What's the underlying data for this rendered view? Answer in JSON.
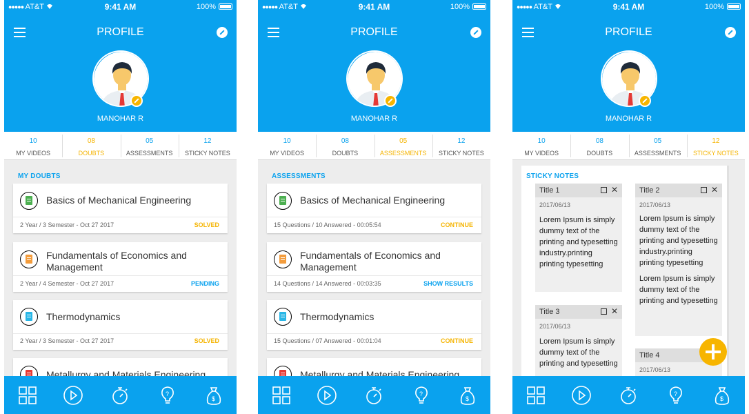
{
  "status_bar": {
    "carrier": "AT&T",
    "time": "9:41 AM",
    "battery": "100%"
  },
  "header": {
    "title": "PROFILE",
    "username": "MANOHAR R"
  },
  "stats": [
    {
      "count": "10",
      "label": "MY VIDEOS"
    },
    {
      "count": "08",
      "label": "DOUBTS"
    },
    {
      "count": "05",
      "label": "ASSESSMENTS"
    },
    {
      "count": "12",
      "label": "STICKY NOTES"
    }
  ],
  "screens": {
    "doubts": {
      "active_tab": 1,
      "section_title": "MY DOUBTS",
      "items": [
        {
          "title": "Basics of Mechanical Engineering",
          "meta": "2 Year / 3 Semester - Oct 27 2017",
          "status": "SOLVED",
          "icon": "document-icon",
          "color": "#4caf50"
        },
        {
          "title": "Fundamentals of Economics and Management",
          "meta": "2 Year / 4 Semester - Oct 27 2017",
          "status": "PENDING",
          "icon": "document-icon",
          "color": "#f39c3c"
        },
        {
          "title": "Thermodynamics",
          "meta": "2 Year / 3 Semester - Oct 27 2017",
          "status": "SOLVED",
          "icon": "document-icon",
          "color": "#29b6e6"
        },
        {
          "title": "Metallurgy and Materials Engineering",
          "icon": "document-icon",
          "color": "#e53935"
        }
      ]
    },
    "assessments": {
      "active_tab": 2,
      "section_title": "ASSESSMENTS",
      "items": [
        {
          "title": "Basics of Mechanical Engineering",
          "meta": "15 Questions / 10 Answered - 00:05:54",
          "status": "CONTINUE"
        },
        {
          "title": "Fundamentals of Economics and Management",
          "meta": "14 Questions / 14 Answered - 00:03:35",
          "status": "SHOW RESULTS"
        },
        {
          "title": "Thermodynamics",
          "meta": "15 Questions / 07 Answered - 00:01:04",
          "status": "CONTINUE"
        },
        {
          "title": "Metallurgy and Materials Engineering"
        }
      ]
    },
    "sticky_notes": {
      "active_tab": 3,
      "section_title": "STICKY NOTES",
      "notes": [
        {
          "title": "Title 1",
          "date": "2017/06/13",
          "body": "Lorem Ipsum is simply dummy text of the printing and typesetting industry.printing printing typesetting"
        },
        {
          "title": "Title 2",
          "date": "2017/06/13",
          "body": "Lorem Ipsum is simply dummy text of the printing and typesetting industry.printing printing typesetting",
          "body2": "Lorem Ipsum is simply dummy text of the printing and typesetting"
        },
        {
          "title": "Title 3",
          "date": "2017/06/13",
          "body": "Lorem Ipsum is simply dummy text of the printing and typesetting"
        },
        {
          "title": "Title 4",
          "date": "2017/06/13"
        }
      ]
    }
  },
  "bottom_nav": [
    "dashboard-grid-icon",
    "play-icon",
    "stopwatch-icon",
    "lightbulb-icon",
    "money-bag-icon"
  ],
  "colors": {
    "primary": "#0aa2ee",
    "accent": "#f5b400",
    "background": "#ededed"
  }
}
